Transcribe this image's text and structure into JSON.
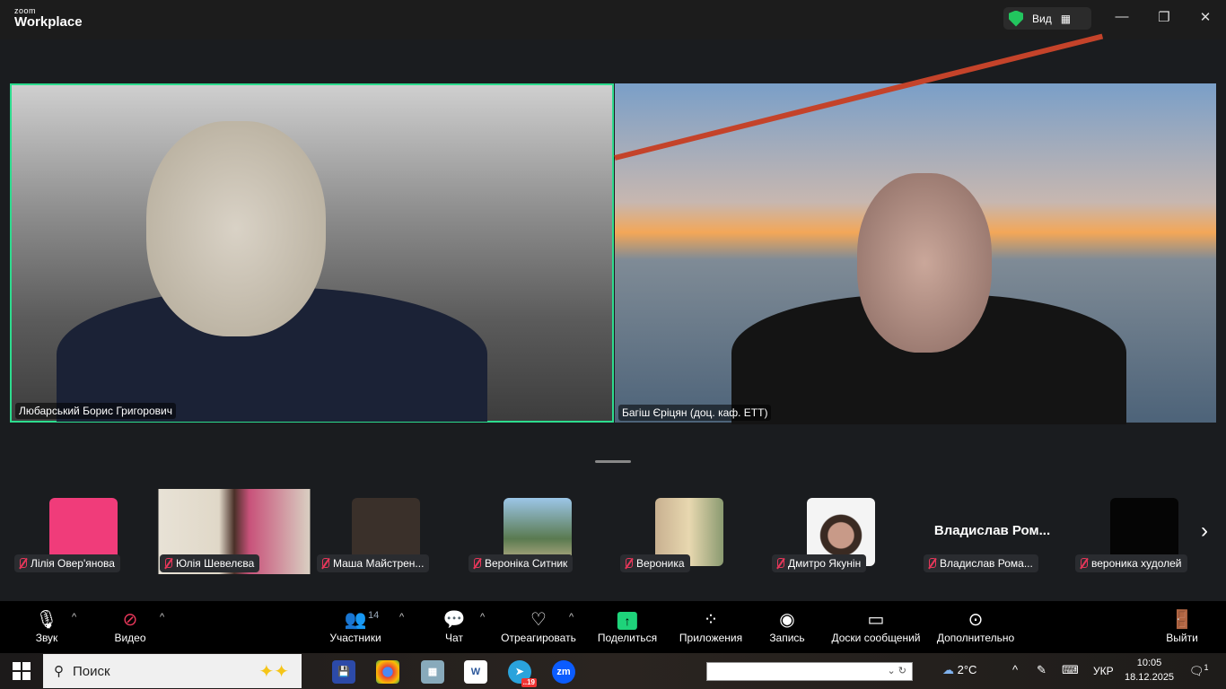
{
  "app": {
    "logo_small": "zoom",
    "logo_main": "Workplace",
    "view_label": "Вид"
  },
  "stage": [
    {
      "name": "Любарський Борис Григорович",
      "active": true
    },
    {
      "name": "Багіш Єріцян (доц. каф. ЕТТ)",
      "active": false
    }
  ],
  "strip": [
    {
      "name": "Лілія Овер'янова",
      "color": "#f03c7a"
    },
    {
      "name": "Юлія Шевелєва",
      "color": "#b89a8c"
    },
    {
      "name": "Маша Майстрен...",
      "color": "#4a3c30"
    },
    {
      "name": "Вероніка Ситник",
      "color": "#7a9a7a"
    },
    {
      "name": "Вероника",
      "color": "#b5a090"
    },
    {
      "name": "Дмитро Якунін",
      "color": "#f4f4f4"
    },
    {
      "name": "Владислав Рома...",
      "display": "Владислав  Ром..."
    },
    {
      "name": "вероника худолей",
      "color": "#050505"
    }
  ],
  "toolbar": {
    "audio": "Звук",
    "video": "Видео",
    "participants": "Участники",
    "participants_count": "14",
    "chat": "Чат",
    "react": "Отреагировать",
    "share": "Поделиться",
    "apps": "Приложения",
    "record": "Запись",
    "whiteboards": "Доски сообщений",
    "more": "Дополнительно",
    "leave": "Выйти"
  },
  "taskbar": {
    "search_placeholder": "Поиск",
    "telegram_badge": "..19",
    "weather": "2°C",
    "lang": "УКР",
    "time": "10:05",
    "date": "18.12.2025",
    "notifications": "1",
    "zoom_app": "zm",
    "word_app": "W"
  }
}
